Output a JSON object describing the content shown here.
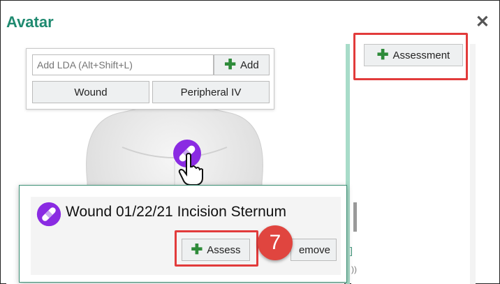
{
  "window": {
    "title": "Avatar",
    "close_label": "✕"
  },
  "lda": {
    "input_placeholder": "Add LDA (Alt+Shift+L)",
    "add_label": "Add",
    "quick_buttons": [
      "Wound",
      "Peripheral IV"
    ]
  },
  "side": {
    "assessment_label": "Assessment"
  },
  "popup": {
    "title": "Wound 01/22/21 Incision Sternum",
    "assess_label": "Assess",
    "remove_label": "emove"
  },
  "callout": {
    "step": "7"
  },
  "colors": {
    "title_green": "#1f8a70",
    "plus_green": "#2e8b3a",
    "highlight_red": "#e23b3b",
    "icon_purple": "#8a2be2"
  },
  "icons": [
    "close-icon",
    "plus-icon",
    "bandage-icon",
    "hand-cursor-icon"
  ]
}
